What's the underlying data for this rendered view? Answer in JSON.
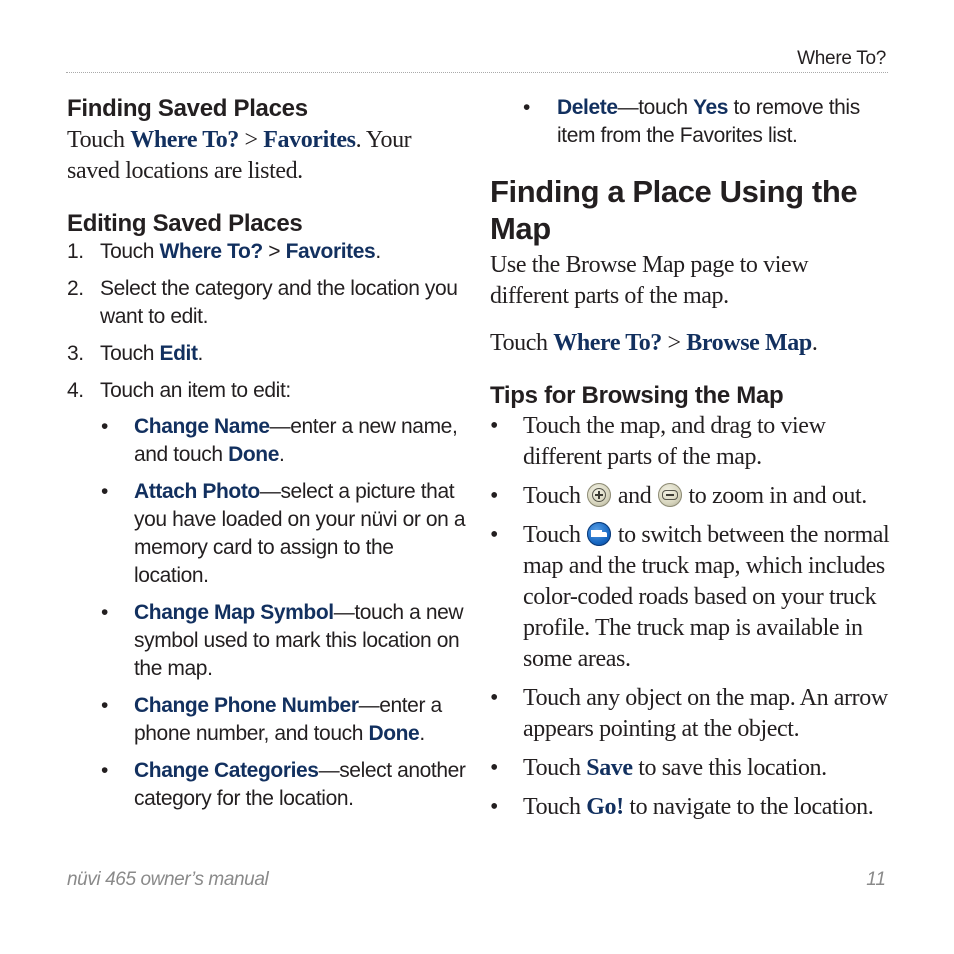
{
  "header": {
    "section_title": "Where To?"
  },
  "footer": {
    "manual_title": "nüvi 465 owner’s manual",
    "page_number": "11"
  },
  "colors": {
    "highlight": "#12305f",
    "text": "#231f20",
    "footer_text": "#8a8a8a",
    "rule": "#aaaaaa"
  },
  "finding_saved_places": {
    "heading": "Finding Saved Places",
    "p1": "Touch ",
    "k1": "Where To?",
    "sep": " > ",
    "k2": "Favorites",
    "p2": ". Your saved locations are listed."
  },
  "editing_saved_places": {
    "heading": "Editing Saved Places",
    "steps": [
      {
        "num": "1.",
        "pre": "Touch ",
        "k1": "Where To?",
        "sep": " > ",
        "k2": "Favorites",
        "post": "."
      },
      {
        "num": "2.",
        "text": "Select the category and the location you want to edit."
      },
      {
        "num": "3.",
        "pre": "Touch ",
        "k1": "Edit",
        "post": "."
      },
      {
        "num": "4.",
        "text": "Touch an item to edit:"
      }
    ],
    "options": [
      {
        "bullet": "•",
        "key": "Change Name",
        "desc": "—enter a new name, and touch ",
        "key2": "Done",
        "post": "."
      },
      {
        "bullet": "•",
        "key": "Attach Photo",
        "desc": "—select a picture that you have loaded on your nüvi or on a memory card to assign to the location."
      },
      {
        "bullet": "•",
        "key": "Change Map Symbol",
        "desc": "—touch a new symbol used to mark this location on the map."
      },
      {
        "bullet": "•",
        "key": "Change Phone Number",
        "desc": "—enter a phone number, and touch ",
        "key2": "Done",
        "post": "."
      },
      {
        "bullet": "•",
        "key": "Change Categories",
        "desc": "—select another category for the location."
      },
      {
        "bullet": "•",
        "key": "Delete",
        "desc": "—touch ",
        "key2": "Yes",
        "post": " to remove this item from the Favorites list."
      }
    ]
  },
  "finding_place_map": {
    "heading": "Finding a Place Using the Map",
    "intro": "Use the Browse Map page to view different parts of the map.",
    "touch_pre": "Touch ",
    "k1": "Where To?",
    "sep": " > ",
    "k2": "Browse Map",
    "post": "."
  },
  "tips": {
    "heading": "Tips for Browsing the Map",
    "items": [
      {
        "bullet": "•",
        "text": "Touch the map, and drag to view different parts of the map."
      },
      {
        "bullet": "•",
        "pre": "Touch ",
        "icon1": "zoom-in-icon",
        "mid": " and ",
        "icon2": "zoom-out-icon",
        "post": " to zoom in and out."
      },
      {
        "bullet": "•",
        "pre": "Touch ",
        "icon": "truck-map-icon",
        "post": " to switch between the normal map and the truck map, which includes color-coded roads based on your truck profile. The truck map is available in some areas."
      },
      {
        "bullet": "•",
        "text": "Touch any object on the map. An arrow appears pointing at the object."
      },
      {
        "bullet": "•",
        "pre": "Touch ",
        "key": "Save",
        "post": " to save this location."
      },
      {
        "bullet": "•",
        "pre": "Touch ",
        "key": "Go!",
        "post": " to navigate to the location."
      }
    ]
  }
}
